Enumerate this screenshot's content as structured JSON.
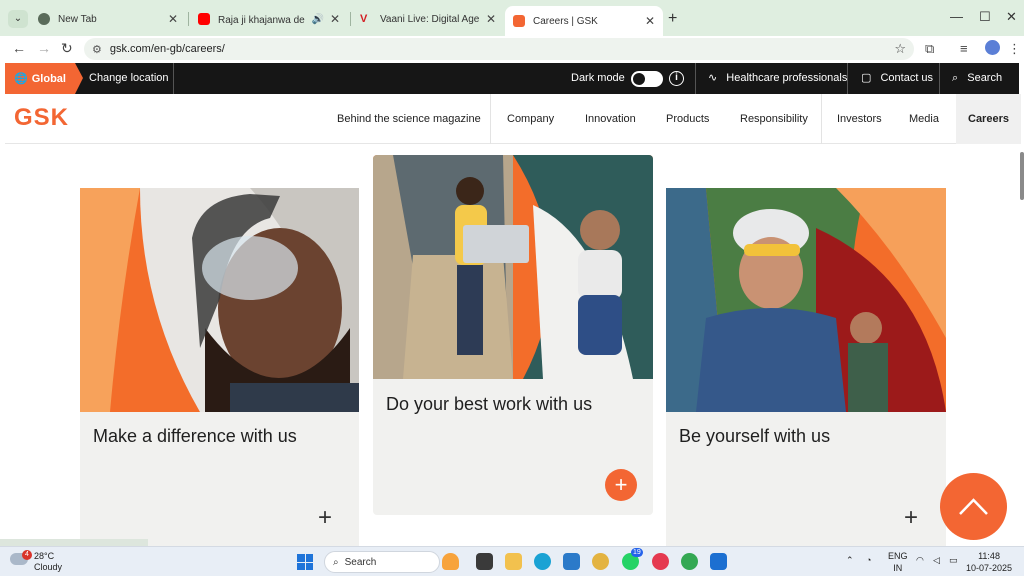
{
  "browser": {
    "tabs": [
      {
        "title": "New Tab",
        "favicon_color": "#5a6b5a",
        "active": false
      },
      {
        "title": "Raja ji khajanwa de da | रा...",
        "favicon_color": "#ff0000",
        "active": false
      },
      {
        "title": "Vaani Live: Digital Agency, Web...",
        "favicon_color": "#d31e24",
        "active": false
      },
      {
        "title": "Careers | GSK",
        "favicon_color": "#f36633",
        "active": true
      }
    ],
    "url": "gsk.com/en-gb/careers/"
  },
  "utility_bar": {
    "global_label": "Global",
    "change_location": "Change location",
    "dark_mode_label": "Dark mode",
    "healthcare_label": "Healthcare professionals",
    "contact_label": "Contact us",
    "search_label": "Search"
  },
  "main_nav": {
    "logo": "GSK",
    "items": [
      "Behind the science magazine",
      "Company",
      "Innovation",
      "Products",
      "Responsibility",
      "Investors",
      "Media",
      "Careers"
    ],
    "active": "Careers"
  },
  "cards": [
    {
      "caption": "Make a difference with us"
    },
    {
      "caption": "Do your best work with us"
    },
    {
      "caption": "Be yourself with us"
    }
  ],
  "taskbar": {
    "weather_temp": "28°C",
    "weather_desc": "Cloudy",
    "weather_badge": "4",
    "search_label": "Search",
    "whatsapp_badge": "19",
    "lang_top": "ENG",
    "lang_bottom": "IN",
    "time": "11:48",
    "date": "10-07-2025"
  },
  "colors": {
    "brand_orange": "#f36633",
    "utility_bg": "#161616",
    "card_bg": "#f1f1ef"
  }
}
